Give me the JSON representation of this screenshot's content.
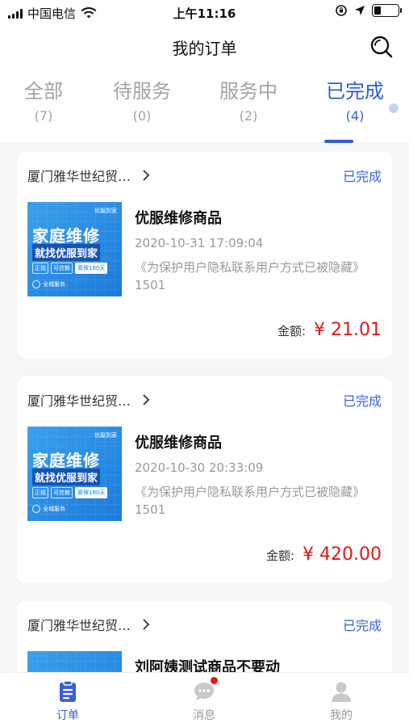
{
  "status_bar": {
    "carrier": "中国电信",
    "time": "上午11:16"
  },
  "nav": {
    "title": "我的订单"
  },
  "tabs": [
    {
      "label": "全部",
      "count": "(7)"
    },
    {
      "label": "待服务",
      "count": "(0)"
    },
    {
      "label": "服务中",
      "count": "(2)"
    },
    {
      "label": "已完成",
      "count": "(4)"
    }
  ],
  "active_tab": "已完成",
  "orders": [
    {
      "shop": "厦门雅华世纪贸…",
      "status": "已完成",
      "product": "优服维修商品",
      "date": "2020-10-31 17:09:04",
      "note": "《为保护用户隐私联系用户方式已被隐藏》1501",
      "amount_label": "金额:",
      "amount": "¥ 21.01"
    },
    {
      "shop": "厦门雅华世纪贸…",
      "status": "已完成",
      "product": "优服维修商品",
      "date": "2020-10-30 20:33:09",
      "note": "《为保护用户隐私联系用户方式已被隐藏》1501",
      "amount_label": "金额:",
      "amount": "¥ 420.00"
    },
    {
      "shop": "厦门雅华世纪贸…",
      "status": "已完成",
      "product": "刘阿姨测试商品不要动"
    }
  ],
  "thumbnail": {
    "brand": "优服到家",
    "line1": "家庭维修",
    "line2": "就找优服到家",
    "tags": [
      "正规",
      "可信赖",
      "质保180天"
    ],
    "bottom": "全城服务"
  },
  "tabbar": [
    {
      "label": "订单",
      "icon": "clipboard-icon"
    },
    {
      "label": "消息",
      "icon": "chat-bubble-icon"
    },
    {
      "label": "我的",
      "icon": "user-icon"
    }
  ],
  "colors": {
    "accent": "#2e5cd6",
    "price": "#e0161b",
    "status": "#3a63d8"
  }
}
